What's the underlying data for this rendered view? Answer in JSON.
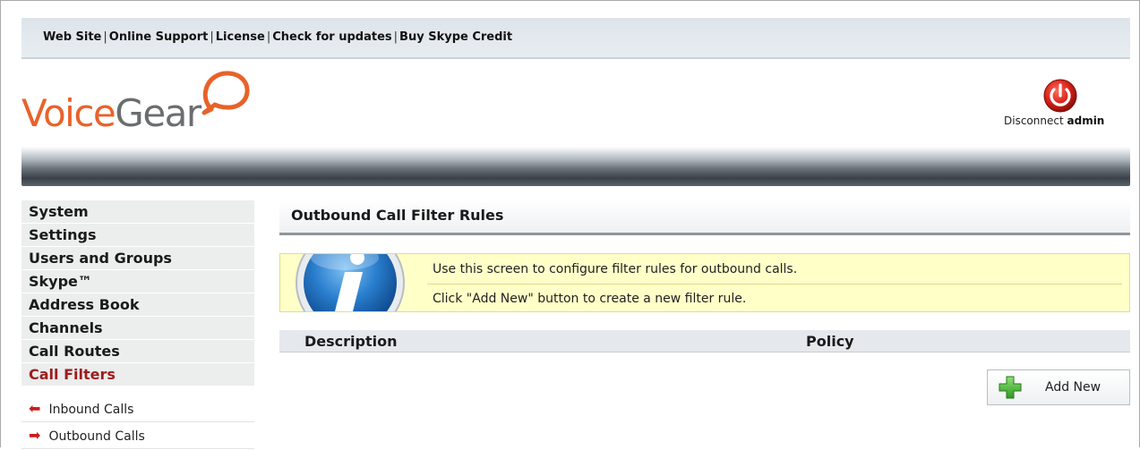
{
  "topbar": {
    "links": [
      "Web Site",
      "Online Support",
      "License",
      "Check for updates",
      "Buy Skype Credit"
    ]
  },
  "logo": {
    "part1": "Voice",
    "part2": "Gear"
  },
  "header": {
    "disconnect_label": "Disconnect",
    "user": "admin"
  },
  "sidebar": {
    "items": [
      {
        "label": "System",
        "active": false
      },
      {
        "label": "Settings",
        "active": false
      },
      {
        "label": "Users and Groups",
        "active": false
      },
      {
        "label": "Skype™",
        "active": false
      },
      {
        "label": "Address Book",
        "active": false
      },
      {
        "label": "Channels",
        "active": false
      },
      {
        "label": "Call Routes",
        "active": false
      },
      {
        "label": "Call Filters",
        "active": true
      }
    ],
    "subitems": [
      {
        "label": "Inbound Calls",
        "icon": "arrow-left-icon"
      },
      {
        "label": "Outbound Calls",
        "icon": "arrow-right-icon"
      }
    ]
  },
  "main": {
    "title": "Outbound Call Filter Rules",
    "info": {
      "line1": "Use this screen to configure filter rules for outbound calls.",
      "line2": "Click \"Add New\" button to create a new filter rule."
    },
    "table": {
      "columns": [
        "Description",
        "Policy"
      ],
      "rows": []
    },
    "add_button_label": "Add New"
  },
  "colors": {
    "brand_orange": "#e8622a",
    "brand_gray": "#6b6e70",
    "active_nav": "#9c1c1c",
    "info_bg": "#ffffc8"
  }
}
